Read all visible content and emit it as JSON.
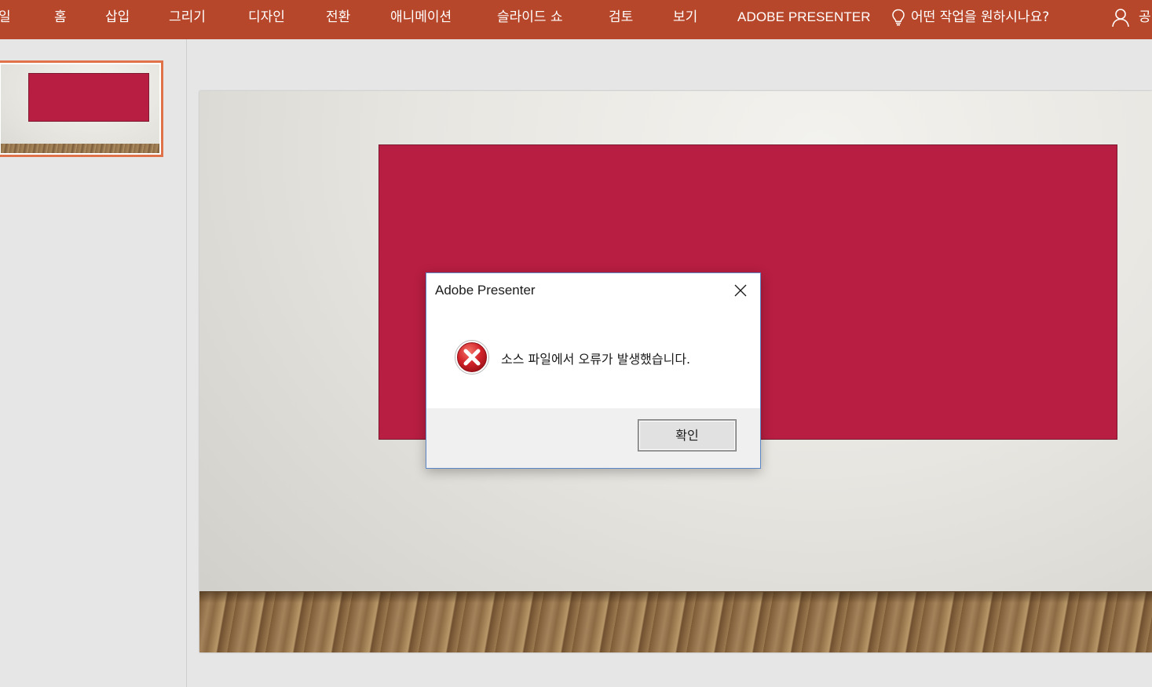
{
  "ribbon": {
    "tabs": [
      {
        "label": "일"
      },
      {
        "label": "홈"
      },
      {
        "label": "삽입"
      },
      {
        "label": "그리기"
      },
      {
        "label": "디자인"
      },
      {
        "label": "전환"
      },
      {
        "label": "애니메이션"
      },
      {
        "label": "슬라이드 쇼"
      },
      {
        "label": "검토"
      },
      {
        "label": "보기"
      },
      {
        "label": "ADOBE PRESENTER"
      }
    ],
    "tell_me": "어떤 작업을 원하시나요?",
    "share_label": "공",
    "accent_color": "#b7472a"
  },
  "slide": {
    "rect_color": "#b81e41",
    "background": "light gray wall with wooden floor"
  },
  "dialog": {
    "title": "Adobe Presenter",
    "message": "소스 파일에서 오류가 발생했습니다.",
    "ok_label": "확인",
    "icon": "error-icon"
  }
}
